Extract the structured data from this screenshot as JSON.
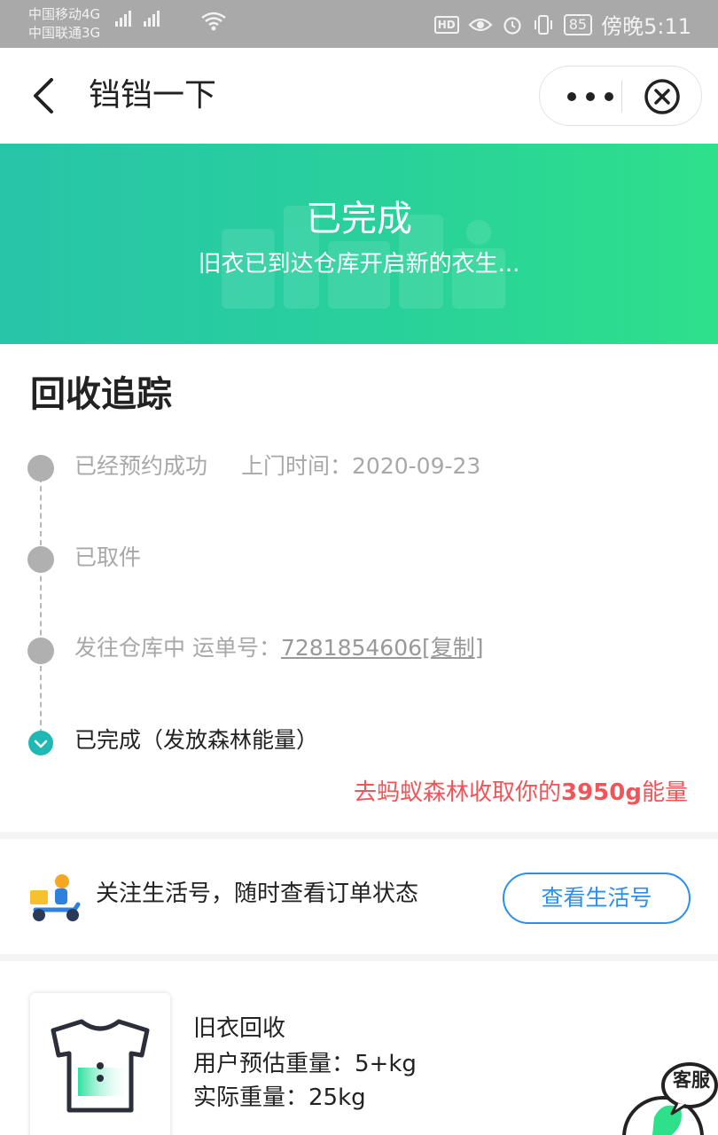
{
  "status_bar": {
    "carrier_1": "中国移动4G",
    "carrier_2": "中国联通3G",
    "net_1": "4G",
    "net_2": "3G",
    "hd": "HD",
    "battery": "85",
    "time": "傍晚5:11"
  },
  "header": {
    "title": "铛铛一下",
    "back_icon": "chevron-left-icon",
    "more_icon": "more-dots-icon",
    "close_icon": "close-circle-icon"
  },
  "hero": {
    "title": "已完成",
    "subtitle": "旧衣已到达仓库开启新的衣生..."
  },
  "tracking": {
    "title": "回收追踪",
    "steps": [
      {
        "label": "已经预约成功",
        "detail": "上门时间：2020-09-23",
        "state": "past"
      },
      {
        "label": "已取件",
        "state": "past"
      },
      {
        "label": "发往仓库中 运单号：",
        "waybill": "7281854606[复制]",
        "state": "past"
      },
      {
        "label": "已完成（发放森林能量）",
        "state": "current"
      }
    ],
    "energy_prefix": "去蚂蚁森林收取你的",
    "energy_amount": "3950g",
    "energy_suffix": "能量"
  },
  "follow": {
    "text": "关注生活号，随时查看订单状态",
    "button": "查看生活号"
  },
  "product": {
    "name": "旧衣回收",
    "estimated": "用户预估重量：5+kg",
    "actual": "实际重量：25kg"
  },
  "service": {
    "label": "客服"
  },
  "colors": {
    "status_bar": "#a9a9a9",
    "hero_start": "#27c5a9",
    "hero_end": "#2ee08a",
    "accent_teal": "#1fb8b3",
    "energy_red": "#f0555a",
    "link_blue": "#2a8ff0"
  }
}
